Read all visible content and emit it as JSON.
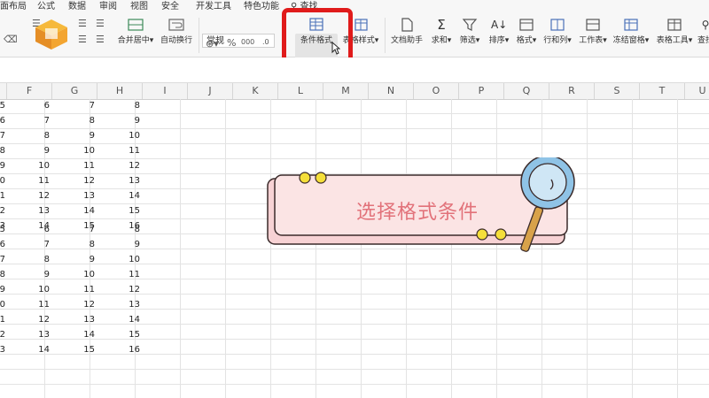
{
  "menu": [
    "面布局",
    "公式",
    "数据",
    "审阅",
    "视图",
    "安全",
    "开发工具",
    "特色功能",
    "查找"
  ],
  "toolbar": {
    "merge_center": "合并居中",
    "auto_wrap": "自动换行",
    "number_format": "常规",
    "percent": "%",
    "thousands": "000",
    "conditional_format": "条件格式",
    "table_style": "表格样式",
    "doc_assistant": "文档助手",
    "sum": "求和",
    "filter": "筛选",
    "sort": "排序",
    "format": "格式",
    "row_col": "行和列",
    "worksheet": "工作表",
    "freeze": "冻结窗格",
    "table_tools": "表格工具",
    "find": "查找"
  },
  "columns": [
    "F",
    "G",
    "H",
    "I",
    "J",
    "K",
    "L",
    "M",
    "N",
    "O",
    "P",
    "Q",
    "R",
    "S",
    "T"
  ],
  "rows_block1": [
    [
      "5",
      "6",
      "7",
      "8"
    ],
    [
      "6",
      "7",
      "8",
      "9"
    ],
    [
      "7",
      "8",
      "9",
      "10"
    ],
    [
      "8",
      "9",
      "10",
      "11"
    ],
    [
      "9",
      "10",
      "11",
      "12"
    ],
    [
      "0",
      "11",
      "12",
      "13"
    ],
    [
      "1",
      "12",
      "13",
      "14"
    ],
    [
      "2",
      "13",
      "14",
      "15"
    ],
    [
      "3",
      "14",
      "15",
      "16"
    ]
  ],
  "rows_block2": [
    [
      "5",
      "6",
      "7",
      "8"
    ],
    [
      "6",
      "7",
      "8",
      "9"
    ],
    [
      "7",
      "8",
      "9",
      "10"
    ],
    [
      "8",
      "9",
      "10",
      "11"
    ],
    [
      "9",
      "10",
      "11",
      "12"
    ],
    [
      "0",
      "11",
      "12",
      "13"
    ],
    [
      "1",
      "12",
      "13",
      "14"
    ],
    [
      "2",
      "13",
      "14",
      "15"
    ],
    [
      "3",
      "14",
      "15",
      "16"
    ]
  ],
  "banner": {
    "text": "选择格式条件",
    "text_color": "#e2727a",
    "fill": "#fbe4e4",
    "accent": "#f5df3a"
  },
  "highlight_color": "#e01b1b"
}
